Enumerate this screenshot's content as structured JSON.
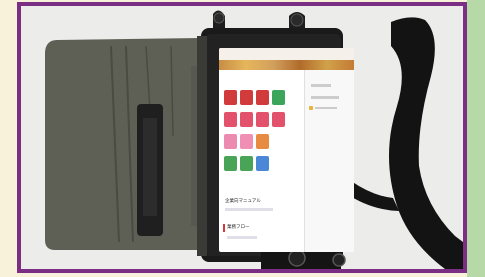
{
  "image": {
    "subject": "tablet-in-case-with-strap",
    "colors": {
      "border": "#7a2e84",
      "background_left": "#f7f2d9",
      "background_right": "#b7d9a8",
      "table": "#ededee",
      "case": "#5e5f55",
      "strap": "#141414"
    }
  },
  "screen": {
    "section_manual": "企業向マニュアル",
    "section_flow": "業務フロー"
  }
}
